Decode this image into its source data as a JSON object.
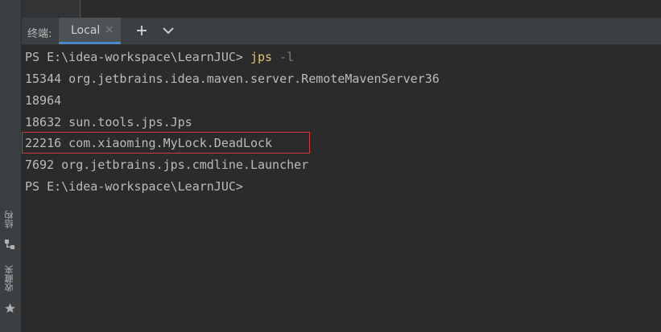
{
  "editor": {},
  "toolwindow": {
    "title": "终端:",
    "tab_label": "Local",
    "close_glyph": "×",
    "add_glyph": "+",
    "icons": [
      "close-icon",
      "add-icon",
      "chevron-down-icon"
    ]
  },
  "terminal": {
    "lines": [
      {
        "prompt": "PS E:\\idea-workspace\\LearnJUC> ",
        "command": "jps",
        "args": " -l"
      },
      {
        "text": "15344 org.jetbrains.idea.maven.server.RemoteMavenServer36"
      },
      {
        "text": "18964"
      },
      {
        "text": "18632 sun.tools.jps.Jps"
      },
      {
        "text": "22216 com.xiaoming.MyLock.DeadLock",
        "highlighted": true
      },
      {
        "text": "7692 org.jetbrains.jps.cmdline.Launcher"
      },
      {
        "prompt": "PS E:\\idea-workspace\\LearnJUC>"
      }
    ]
  },
  "sidebar": {
    "items": [
      {
        "label": "结构",
        "icon": "structure-icon"
      },
      {
        "label": "收藏夹",
        "icon": "star-icon"
      }
    ]
  },
  "colors": {
    "background": "#2b2b2b",
    "panel": "#3c3f41",
    "accent": "#4a88c7",
    "command": "#e0c46c",
    "highlight_border": "#d23a3a"
  }
}
